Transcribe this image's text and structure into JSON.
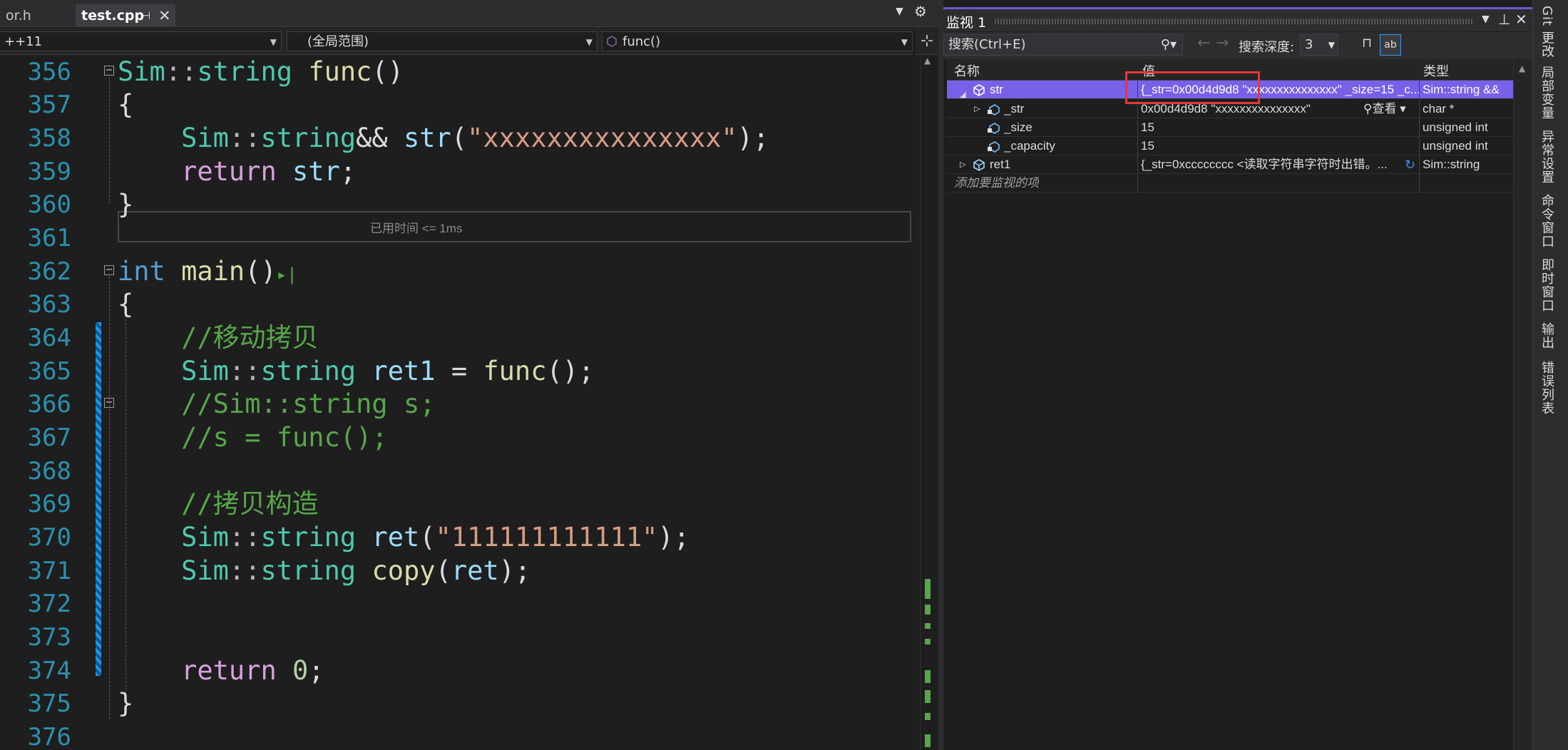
{
  "tabs": [
    {
      "label": "or.h"
    },
    {
      "label": "test.cpp",
      "active": true
    }
  ],
  "navbar": {
    "project": "++11",
    "scope": "(全局范围)",
    "function": "func()"
  },
  "editor": {
    "line_numbers": [
      "356",
      "357",
      "358",
      "359",
      "360",
      "361",
      "362",
      "363",
      "364",
      "365",
      "366",
      "367",
      "368",
      "369",
      "370",
      "371",
      "372",
      "373",
      "374",
      "375",
      "376"
    ],
    "perf_tip": "已用时间 <= 1ms",
    "comment_move": "//移动拷贝",
    "comment_copy": "//拷贝构造"
  },
  "watch": {
    "title": "监视 1",
    "search_placeholder": "搜索(Ctrl+E)",
    "depth_label": "搜索深度:",
    "depth_value": "3",
    "col_name": "名称",
    "col_value": "值",
    "col_type": "类型",
    "rows": [
      {
        "name": "str",
        "value": "{_str=0x00d4d9d8 \"xxxxxxxxxxxxxxx\" _size=15 _c...",
        "type": "Sim::string &&"
      },
      {
        "name": "_str",
        "value": "0x00d4d9d8 \"xxxxxxxxxxxxxxx\"",
        "view": "查看",
        "type": "char *"
      },
      {
        "name": "_size",
        "value": "15",
        "type": "unsigned int"
      },
      {
        "name": "_capacity",
        "value": "15",
        "type": "unsigned int"
      },
      {
        "name": "ret1",
        "value": "{_str=0xcccccccc <读取字符串字符时出错。...",
        "type": "Sim::string"
      }
    ],
    "add_placeholder": "添加要监视的项"
  },
  "rail": [
    "Git 更改",
    "局部变量",
    "异常设置",
    "命令窗口",
    "即时窗口",
    "输出",
    "错误列表"
  ]
}
